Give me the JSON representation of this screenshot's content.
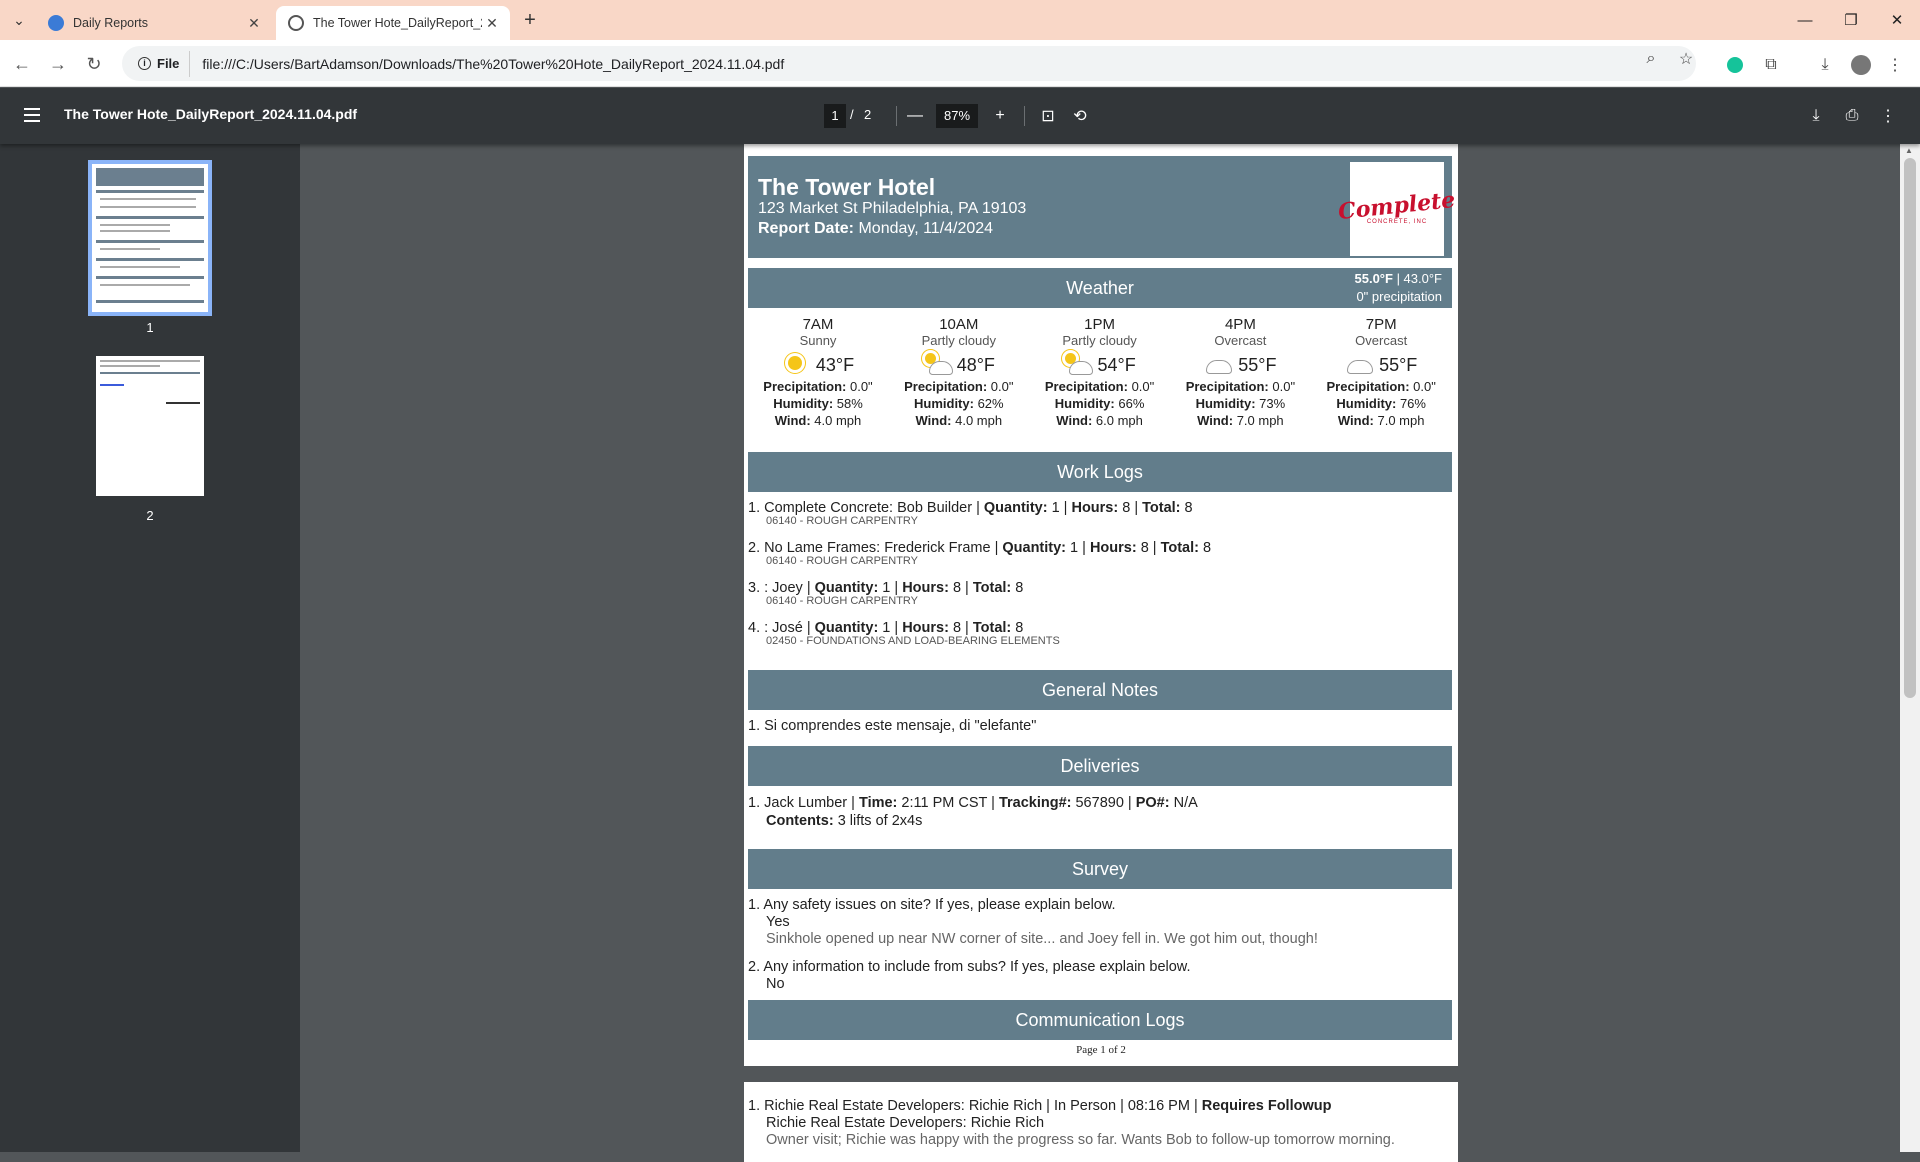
{
  "browser": {
    "tabs": [
      {
        "title": "Daily Reports",
        "active": false
      },
      {
        "title": "The Tower Hote_DailyReport_2024.11.04.pdf",
        "active": true
      }
    ],
    "site_chip": "File",
    "url": "file:///C:/Users/BartAdamson/Downloads/The%20Tower%20Hote_DailyReport_2024.11.04.pdf"
  },
  "pdf": {
    "title": "The Tower Hote_DailyReport_2024.11.04.pdf",
    "current_page": "1",
    "page_sep": "/",
    "total_pages": "2",
    "zoom": "87%",
    "thumbnails": [
      "1",
      "2"
    ]
  },
  "report": {
    "hotel": "The Tower Hotel",
    "address": "123 Market St Philadelphia, PA 19103",
    "date_label": "Report Date:",
    "date_value": " Monday, 11/4/2024",
    "logo_text": "Complete",
    "logo_sub": "CONCRETE, INC",
    "weather_title": "Weather",
    "weather_summary_hi": "55.0°F",
    "weather_summary_lo": " | 43.0°F",
    "weather_summary_precip": "0\" precipitation",
    "weather": [
      {
        "time": "7AM",
        "cond": "Sunny",
        "icon": "sun-icon",
        "temp": "43°F",
        "precip": " 0.0\"",
        "humidity": " 58%",
        "wind": " 4.0 mph"
      },
      {
        "time": "10AM",
        "cond": "Partly cloudy",
        "icon": "partly-cloudy-icon",
        "temp": "48°F",
        "precip": " 0.0\"",
        "humidity": " 62%",
        "wind": " 4.0 mph"
      },
      {
        "time": "1PM",
        "cond": "Partly cloudy",
        "icon": "partly-cloudy-icon",
        "temp": "54°F",
        "precip": " 0.0\"",
        "humidity": " 66%",
        "wind": " 6.0 mph"
      },
      {
        "time": "4PM",
        "cond": "Overcast",
        "icon": "cloud-icon",
        "temp": "55°F",
        "precip": " 0.0\"",
        "humidity": " 73%",
        "wind": " 7.0 mph"
      },
      {
        "time": "7PM",
        "cond": "Overcast",
        "icon": "cloud-icon",
        "temp": "55°F",
        "precip": " 0.0\"",
        "humidity": " 76%",
        "wind": " 7.0 mph"
      }
    ],
    "labels": {
      "precip": "Precipitation:",
      "humidity": "Humidity:",
      "wind": "Wind:",
      "quantity": "Quantity:",
      "hours": "Hours:",
      "total": "Total:",
      "time": "Time:",
      "tracking": "Tracking#:",
      "po": "PO#:",
      "contents": "Contents:",
      "requires_followup": "Requires Followup"
    },
    "work_logs_title": "Work Logs",
    "work_logs": [
      {
        "num": "1.",
        "name": "Complete Concrete: Bob Builder",
        "quantity": " 1",
        "hours": " 8",
        "total": " 8",
        "code": "06140 - ROUGH CARPENTRY"
      },
      {
        "num": "2.",
        "name": "No Lame Frames: Frederick Frame",
        "quantity": " 1",
        "hours": " 8",
        "total": " 8",
        "code": "06140 - ROUGH CARPENTRY"
      },
      {
        "num": "3.",
        "name": ": Joey",
        "quantity": " 1",
        "hours": " 8",
        "total": " 8",
        "code": "06140 - ROUGH CARPENTRY"
      },
      {
        "num": "4.",
        "name": ": José",
        "quantity": " 1",
        "hours": " 8",
        "total": " 8",
        "code": "02450 - FOUNDATIONS AND LOAD-BEARING ELEMENTS"
      }
    ],
    "general_notes_title": "General Notes",
    "general_notes": [
      "1. Si comprendes este mensaje, di \"elefante\""
    ],
    "deliveries_title": "Deliveries",
    "delivery": {
      "num": "1.",
      "vendor": "Jack Lumber",
      "time": " 2:11 PM CST",
      "tracking": " 567890",
      "po": " N/A",
      "contents": " 3 lifts of 2x4s"
    },
    "survey_title": "Survey",
    "survey": [
      {
        "q": "1. Any safety issues on site? If yes, please explain below.",
        "a": "Yes",
        "detail": "Sinkhole opened up near NW corner of site... and Joey fell in. We got him out, though!"
      },
      {
        "q": "2. Any information to include from subs? If yes, please explain below.",
        "a": "No",
        "detail": ""
      }
    ],
    "comm_title": "Communication Logs",
    "page_footer": "Page 1 of 2",
    "comm_log": {
      "line1": "1. Richie Real Estate Developers: Richie Rich | In Person | 08:16 PM | ",
      "line2": "Richie Real Estate Developers: Richie Rich",
      "line3": "Owner visit; Richie was happy with the progress so far. Wants Bob to follow-up tomorrow morning."
    }
  }
}
